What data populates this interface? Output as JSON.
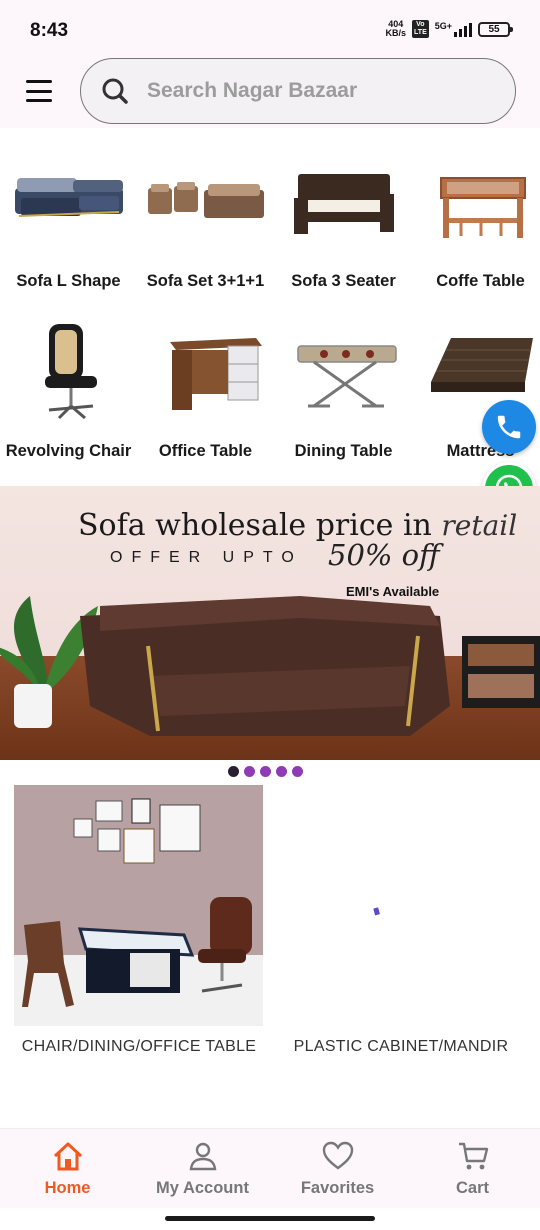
{
  "status_bar": {
    "time": "8:43",
    "net_speed_value": "404",
    "net_speed_unit": "KB/s",
    "volte_top": "Vo",
    "volte_bottom": "LTE",
    "network_type": "5G+",
    "battery": "55"
  },
  "header": {
    "search_placeholder": "Search Nagar Bazaar",
    "menu_icon": "hamburger-menu-icon",
    "search_icon": "search-icon"
  },
  "categories": [
    {
      "label": "Sofa L Shape",
      "icon": "l-shape-sofa-image"
    },
    {
      "label": "Sofa Set 3+1+1",
      "icon": "sofa-set-image"
    },
    {
      "label": "Sofa 3 Seater",
      "icon": "three-seater-sofa-image"
    },
    {
      "label": "Coffe Table",
      "icon": "coffee-table-image"
    },
    {
      "label": "Revolving Chair",
      "icon": "revolving-chair-image"
    },
    {
      "label": "Office Table",
      "icon": "office-table-image"
    },
    {
      "label": "Dining Table",
      "icon": "dining-table-image"
    },
    {
      "label": "Mattress",
      "icon": "mattress-image"
    }
  ],
  "floating_buttons": {
    "phone_icon": "phone-icon",
    "whatsapp_icon": "whatsapp-icon"
  },
  "banner": {
    "title_main": "Sofa wholesale price in ",
    "title_script": "retail",
    "offer": "OFFER UPTO",
    "percent": "50% off",
    "emi": "EMI's Available"
  },
  "carousel": {
    "count": 5,
    "active_index": 0
  },
  "products": [
    {
      "label": "CHAIR/DINING/OFFICE TABLE"
    },
    {
      "label": "PLASTIC CABINET/MANDIR"
    }
  ],
  "bottom_nav": [
    {
      "label": "Home",
      "icon": "home-icon",
      "active": true
    },
    {
      "label": "My Account",
      "icon": "person-icon",
      "active": false
    },
    {
      "label": "Favorites",
      "icon": "heart-icon",
      "active": false
    },
    {
      "label": "Cart",
      "icon": "cart-icon",
      "active": false
    }
  ],
  "colors": {
    "accent": "#f05a22",
    "phone_button": "#1e88e5",
    "whatsapp_button": "#1fc04b",
    "dot": "#8e3bb8",
    "dot_active": "#2a1f33"
  }
}
